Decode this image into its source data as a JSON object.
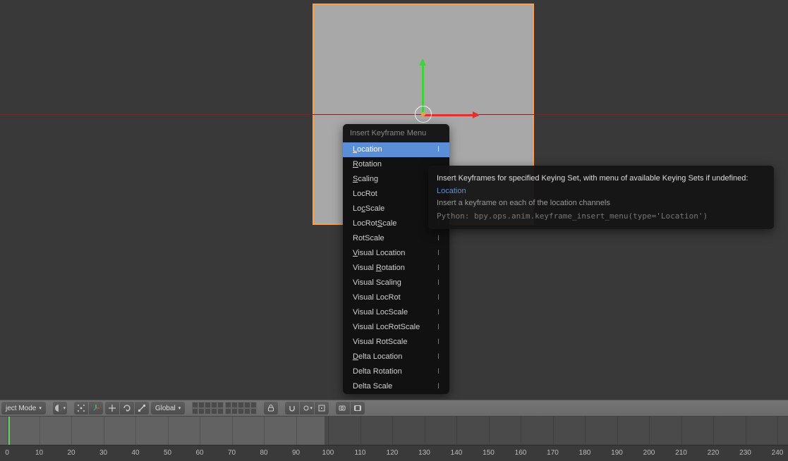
{
  "viewport": {
    "object_selected": "Cube"
  },
  "popup": {
    "title": "Insert Keyframe Menu",
    "items": [
      {
        "label": "Location",
        "shortcut": "I",
        "hl": true,
        "u": 0
      },
      {
        "label": "Rotation",
        "shortcut": "",
        "u": 0
      },
      {
        "label": "Scaling",
        "shortcut": "",
        "u": 0
      },
      {
        "label": "LocRot",
        "shortcut": "",
        "u": -1
      },
      {
        "label": "LocScale",
        "shortcut": "I",
        "u": 2
      },
      {
        "label": "LocRotScale",
        "shortcut": "I",
        "u": 6
      },
      {
        "label": "RotScale",
        "shortcut": "I",
        "u": -1
      },
      {
        "label": "Visual Location",
        "shortcut": "I",
        "u": 0
      },
      {
        "label": "Visual Rotation",
        "shortcut": "I",
        "u": 7
      },
      {
        "label": "Visual Scaling",
        "shortcut": "I",
        "u": -1
      },
      {
        "label": "Visual LocRot",
        "shortcut": "I",
        "u": -1
      },
      {
        "label": "Visual LocScale",
        "shortcut": "I",
        "u": -1
      },
      {
        "label": "Visual LocRotScale",
        "shortcut": "I",
        "u": -1
      },
      {
        "label": "Visual RotScale",
        "shortcut": "I",
        "u": -1
      },
      {
        "label": "Delta Location",
        "shortcut": "I",
        "u": 0
      },
      {
        "label": "Delta Rotation",
        "shortcut": "I",
        "u": -1
      },
      {
        "label": "Delta Scale",
        "shortcut": "I",
        "u": -1
      }
    ]
  },
  "tooltip": {
    "main": "Insert Keyframes for specified Keying Set, with menu of available Keying Sets if undefined:",
    "main_link": "Location",
    "sub": "Insert a keyframe on each of the location channels",
    "python": "Python: bpy.ops.anim.keyframe_insert_menu(type='Location')"
  },
  "header": {
    "mode": "ject Mode",
    "orientation": "Global"
  },
  "timeline": {
    "start": 0,
    "end_range": 100,
    "ticks": [
      0,
      10,
      20,
      30,
      40,
      50,
      60,
      70,
      80,
      90,
      100,
      110,
      120,
      130,
      140,
      150,
      160,
      170,
      180,
      190,
      200,
      210,
      220,
      230,
      240
    ]
  }
}
